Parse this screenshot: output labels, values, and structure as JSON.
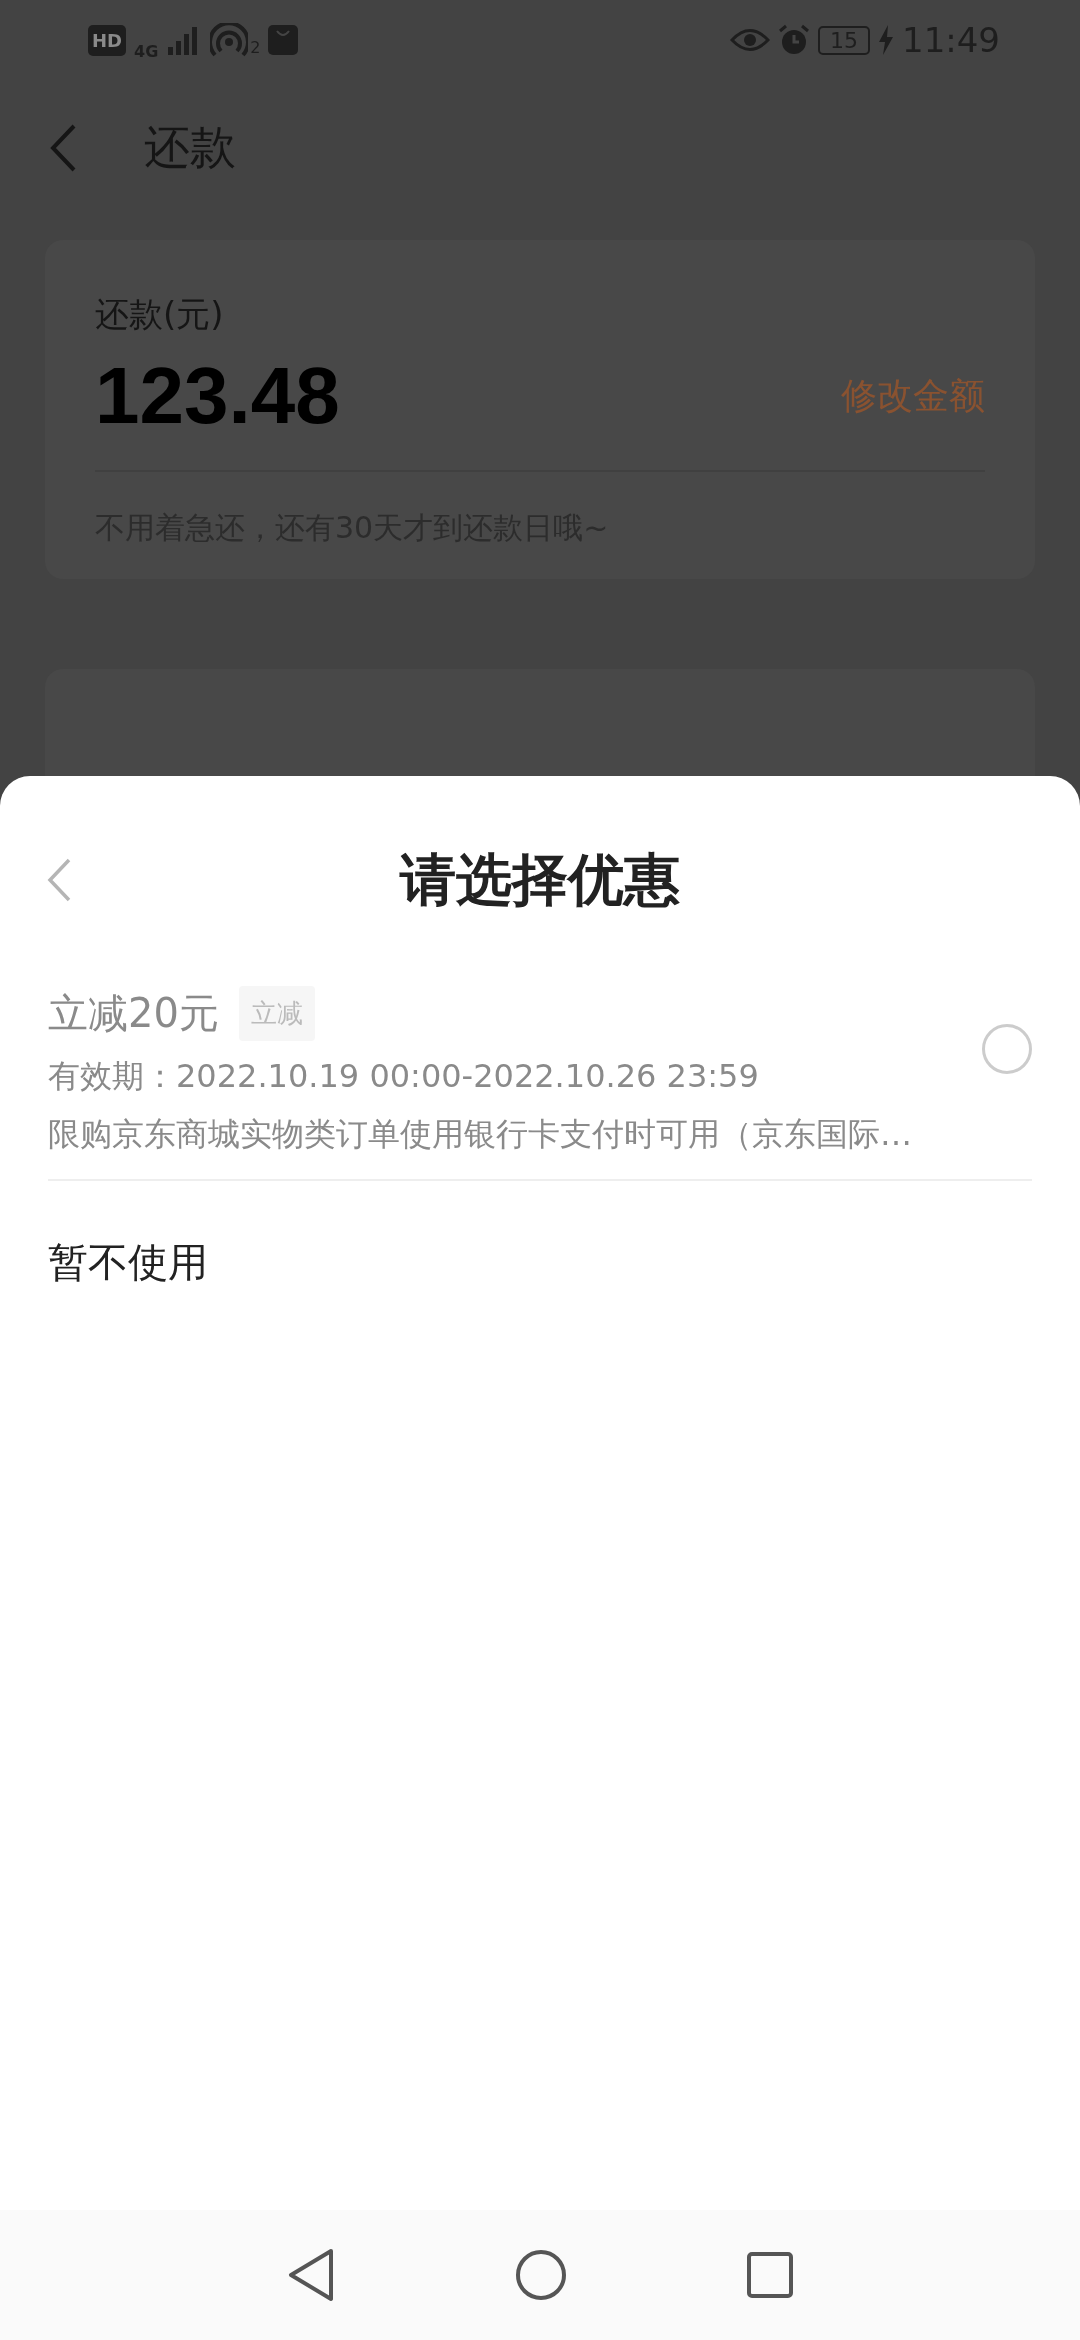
{
  "status_bar": {
    "hd": "HD",
    "network": "4G",
    "hotspot_count": "2",
    "battery": "15",
    "time": "11:49"
  },
  "page": {
    "title": "还款",
    "amount_label": "还款(元)",
    "amount": "123.48",
    "edit_link": "修改金额",
    "note": "不用着急还，还有30天才到还款日哦~"
  },
  "sheet": {
    "title": "请选择优惠",
    "coupons": [
      {
        "title": "立减20元",
        "tag": "立减",
        "validity": "有效期：2022.10.19 00:00-2022.10.26 23:59",
        "description": "限购京东商城实物类订单使用银行卡支付时可用（京东国际…",
        "selected": false
      }
    ],
    "no_use": "暂不使用"
  }
}
